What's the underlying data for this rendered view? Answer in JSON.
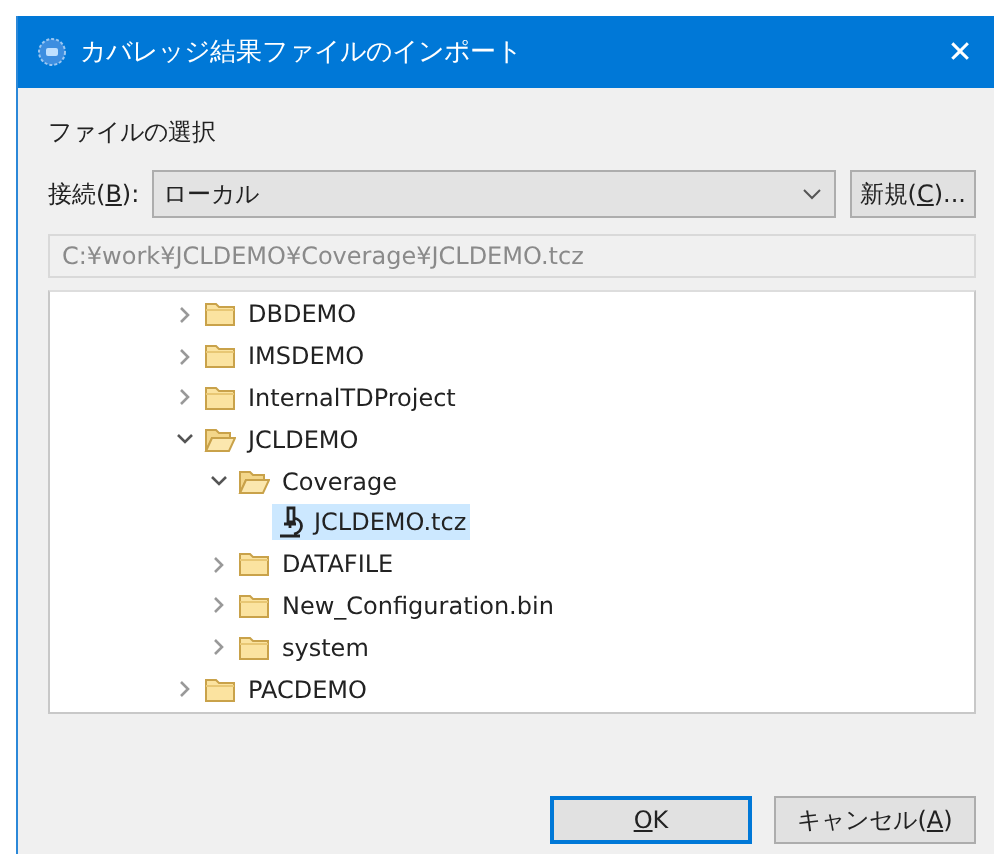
{
  "window": {
    "title": "カバレッジ結果ファイルのインポート",
    "close": "✕"
  },
  "section_label": "ファイルの選択",
  "connection": {
    "label_before": "接続(",
    "mnemonic": "B",
    "label_after": "):",
    "value": "ローカル"
  },
  "new_button": {
    "label_before": "新規(",
    "mnemonic": "C",
    "label_after": ")..."
  },
  "path": {
    "value": "C:¥work¥JCLDEMO¥Coverage¥JCLDEMO.tcz",
    "disabled": true
  },
  "tree": [
    {
      "kind": "folder",
      "label": "DBDEMO",
      "expanded": false,
      "selected": false
    },
    {
      "kind": "folder",
      "label": "IMSDEMO",
      "expanded": false,
      "selected": false
    },
    {
      "kind": "folder",
      "label": "InternalTDProject",
      "expanded": false,
      "selected": false
    },
    {
      "kind": "folder",
      "label": "JCLDEMO",
      "expanded": true,
      "selected": false,
      "children": [
        {
          "kind": "folder",
          "label": "Coverage",
          "expanded": true,
          "selected": false,
          "children": [
            {
              "kind": "file",
              "label": "JCLDEMO.tcz",
              "selected": true
            }
          ]
        },
        {
          "kind": "folder",
          "label": "DATAFILE",
          "expanded": false,
          "selected": false
        },
        {
          "kind": "folder",
          "label": "New_Configuration.bin",
          "expanded": false,
          "selected": false
        },
        {
          "kind": "folder",
          "label": "system",
          "expanded": false,
          "selected": false
        }
      ]
    },
    {
      "kind": "folder",
      "label": "PACDEMO",
      "expanded": false,
      "selected": false
    }
  ],
  "buttons": [
    {
      "mnemonic": "O",
      "label_after": "K",
      "default": true
    },
    {
      "label_before": "キャンセル(",
      "mnemonic": "A",
      "label_after": ")",
      "default": false
    }
  ]
}
